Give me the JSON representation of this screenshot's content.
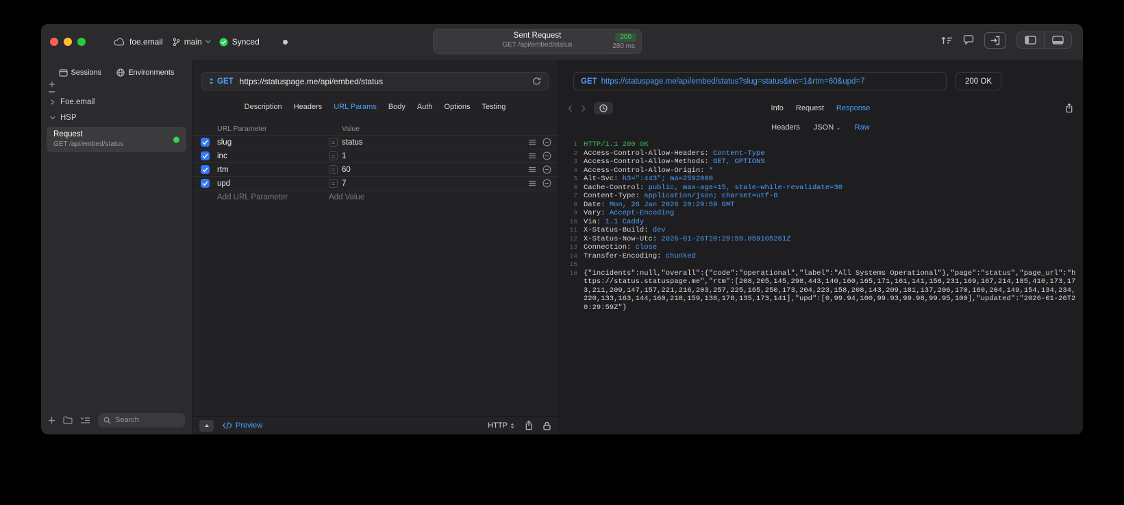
{
  "titlebar": {
    "project": "foe.email",
    "branch": "main",
    "sync": "Synced",
    "request_summary": {
      "title": "Sent Request",
      "status_code": "200",
      "method_path": "GET /api/embed/status",
      "duration": "280 ms"
    }
  },
  "sidebar": {
    "tabs": [
      {
        "label": "Sessions"
      },
      {
        "label": "Environments"
      }
    ],
    "tree": [
      {
        "label": "Foe.email"
      },
      {
        "label": "HSP"
      }
    ],
    "request_item": {
      "title": "Request",
      "subtitle": "GET /api/embed/status"
    },
    "search_placeholder": "Search"
  },
  "request": {
    "method": "GET",
    "url": "https://statuspage.me/api/embed/status",
    "tabs": [
      "Description",
      "Headers",
      "URL Params",
      "Body",
      "Auth",
      "Options",
      "Testing"
    ],
    "active_tab": "URL Params",
    "params": {
      "col_name": "URL Parameter",
      "col_value": "Value",
      "rows": [
        {
          "name": "slug",
          "value": "status",
          "enabled": true
        },
        {
          "name": "inc",
          "value": "1",
          "enabled": true
        },
        {
          "name": "rtm",
          "value": "60",
          "enabled": true
        },
        {
          "name": "upd",
          "value": "7",
          "enabled": true
        }
      ],
      "add_name": "Add URL Parameter",
      "add_value": "Add Value"
    },
    "footer": {
      "preview": "Preview",
      "protocol": "HTTP"
    }
  },
  "response": {
    "method": "GET",
    "url": "https://statuspage.me/api/embed/status?slug=status&inc=1&rtm=60&upd=7",
    "status": "200 OK",
    "tabs": [
      "Info",
      "Request",
      "Response"
    ],
    "active_tab": "Response",
    "subtabs": [
      "Headers",
      "JSON",
      "Raw"
    ],
    "active_subtab": "Raw",
    "status_line": "HTTP/1.1 200 OK",
    "headers": [
      {
        "name": "Access-Control-Allow-Headers",
        "value": "Content-Type"
      },
      {
        "name": "Access-Control-Allow-Methods",
        "value": "GET, OPTIONS"
      },
      {
        "name": "Access-Control-Allow-Origin",
        "value": "*"
      },
      {
        "name": "Alt-Svc",
        "value": "h3=\":443\"; ma=2592000"
      },
      {
        "name": "Cache-Control",
        "value": "public, max-age=15, stale-while-revalidate=30"
      },
      {
        "name": "Content-Type",
        "value": "application/json; charset=utf-8"
      },
      {
        "name": "Date",
        "value": "Mon, 26 Jan 2026 20:29:59 GMT"
      },
      {
        "name": "Vary",
        "value": "Accept-Encoding"
      },
      {
        "name": "Via",
        "value": "1.1 Caddy"
      },
      {
        "name": "X-Status-Build",
        "value": "dev"
      },
      {
        "name": "X-Status-Now-Utc",
        "value": "2026-01-26T20:29:59.859105261Z"
      },
      {
        "name": "Connection",
        "value": "close"
      },
      {
        "name": "Transfer-Encoding",
        "value": "chunked"
      }
    ],
    "body": "{\"incidents\":null,\"overall\":{\"code\":\"operational\",\"label\":\"All Systems Operational\"},\"page\":\"status\",\"page_url\":\"https://status.statuspage.me\",\"rtm\":[208,205,145,298,443,140,160,165,171,161,141,156,231,169,167,214,185,410,173,173,211,209,147,157,221,216,203,257,225,165,250,173,204,223,158,208,143,209,181,137,206,170,160,204,149,154,134,234,220,133,163,144,160,218,159,138,178,135,173,141],\"upd\":[0,99.94,100,99.93,99.98,99.95,100],\"updated\":\"2026-01-26T20:29:59Z\"}"
  }
}
